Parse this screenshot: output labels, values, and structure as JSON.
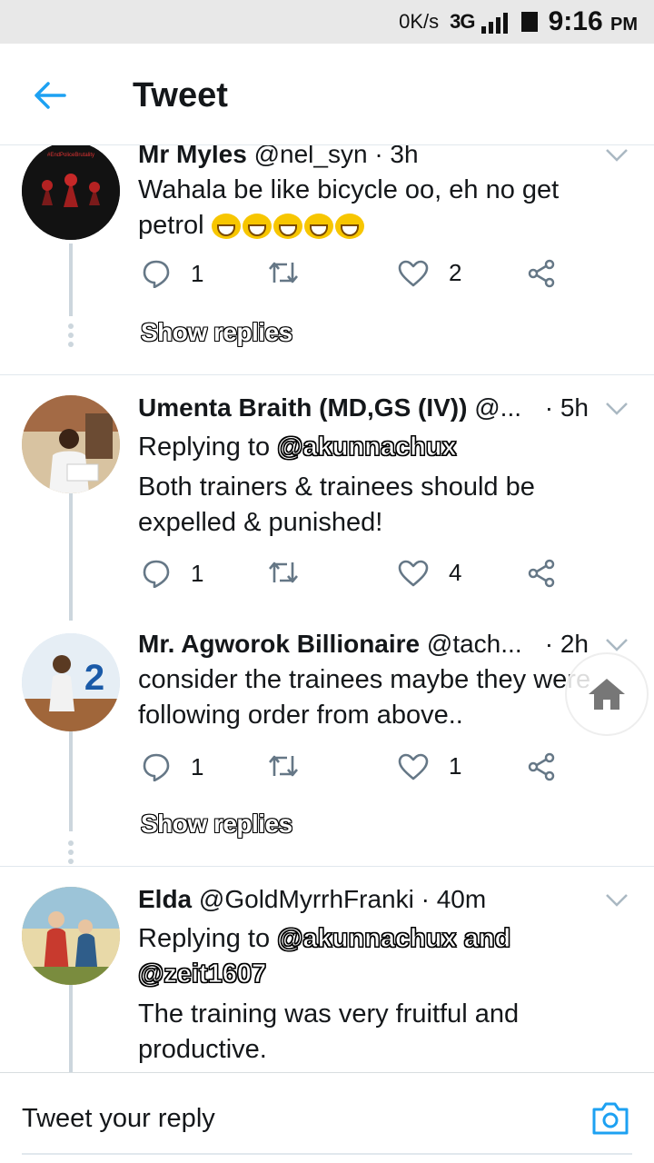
{
  "status_bar": {
    "net_speed": "0K/s",
    "network": "3G",
    "network_label": "3G",
    "time": "9:16",
    "ampm": "PM"
  },
  "app_bar": {
    "title": "Tweet"
  },
  "tweets": [
    {
      "name": "Mr Myles",
      "handle": "@nel_syn",
      "time": "· 3h",
      "text_lines": [
        "Wahala be like bicycle oo, eh no get",
        "petrol"
      ],
      "emoji_count": 5,
      "replies": "1",
      "likes": "2",
      "avatar_text": "#EndPoliceBrutality",
      "show_replies": "Show replies"
    },
    {
      "name": "Umenta Braith (MD,GS (IV))",
      "handle": "@...",
      "time": "· 5h",
      "replying_prefix": "Replying to",
      "replying_to": "@akunnachux",
      "text_lines": [
        "Both trainers & trainees should be",
        "expelled & punished!"
      ],
      "replies": "1",
      "likes": "4"
    },
    {
      "name": "Mr. Agworok Billionaire",
      "handle": "@tach...",
      "time": "· 2h",
      "text_lines": [
        "consider the trainees maybe they were",
        "following order from above.."
      ],
      "replies": "1",
      "likes": "1",
      "avatar_badge": "2",
      "show_replies": "Show replies"
    },
    {
      "name": "Elda",
      "handle": "@GoldMyrrhFranki",
      "time": "· 40m",
      "replying_prefix": "Replying to",
      "replying_to": "@akunnachux and",
      "replying_to_2": "@zeit1607",
      "text_lines": [
        "The training was very fruitful and",
        "productive."
      ]
    }
  ],
  "reply_bar": {
    "placeholder": "Tweet your reply"
  },
  "colors": {
    "accent": "#1da1f2",
    "icon": "#657786",
    "divider": "#e1e8ed"
  }
}
